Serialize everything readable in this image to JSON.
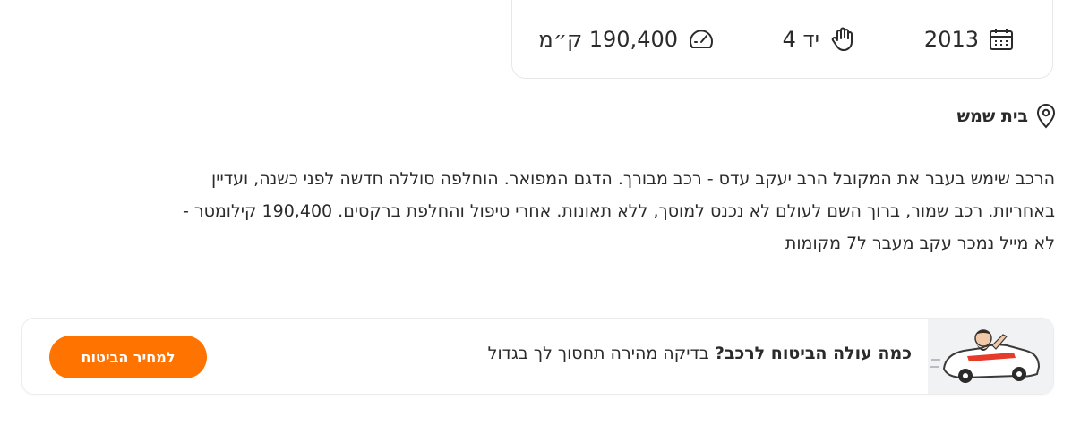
{
  "specs": {
    "year": "2013",
    "hand": "יד 4",
    "mileage": "190,400 ק״מ",
    "year_icon": "calendar-icon",
    "hand_icon": "hand-icon",
    "mileage_icon": "speedometer-icon"
  },
  "location": {
    "city": "בית שמש",
    "icon": "location-pin-icon"
  },
  "description": [
    "הרכב שימש בעבר את המקובל הרב יעקב עדס - רכב מבורך. הדגם המפואר. הוחלפה סוללה חדשה לפני כשנה, ועדיין",
    "באחריות. רכב שמור, ברוך השם לעולם לא נכנס למוסך, ללא תאונות. אחרי טיפול והחלפת ברקסים. 190,400 קילומטר -",
    "לא מייל נמכר עקב מעבר ל7 מקומות"
  ],
  "insurance_banner": {
    "title": "כמה עולה הביטוח לרכב?",
    "subtitle": " בדיקה מהירה תחסוך לך בגדול",
    "button_label": "למחיר הביטוח",
    "button_color": "#ff7300"
  }
}
